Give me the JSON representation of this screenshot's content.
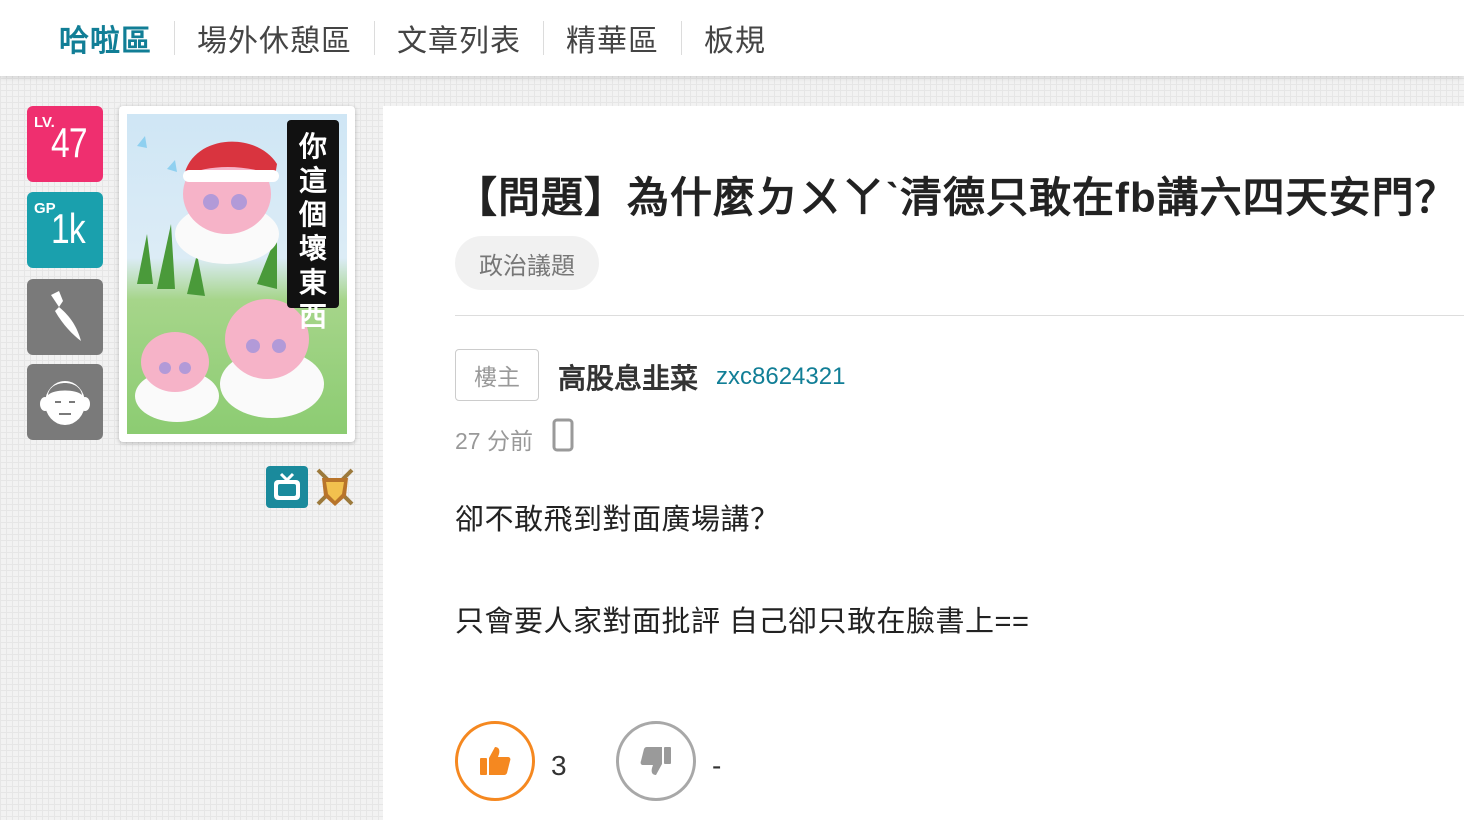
{
  "nav": {
    "items": [
      {
        "label": "哈啦區",
        "active": true
      },
      {
        "label": "場外休憩區",
        "active": false
      },
      {
        "label": "文章列表",
        "active": false
      },
      {
        "label": "精華區",
        "active": false
      },
      {
        "label": "板規",
        "active": false
      }
    ]
  },
  "user_badges": {
    "level_label": "LV.",
    "level_value": "47",
    "gp_label": "GP",
    "gp_value": "1k",
    "sword_icon": "sword-icon",
    "face_icon": "face-icon"
  },
  "avatar": {
    "caption_chars": [
      "你",
      "這",
      "個",
      "壞",
      "東",
      "西"
    ]
  },
  "post": {
    "title": "【問題】為什麼ㄉㄨㄚˋ清德只敢在fb講六四天安門？",
    "tag": "政治議題",
    "role_badge": "樓主",
    "author_name": "高股息韭菜",
    "author_id": "zxc8624321",
    "time": "27 分前",
    "device_icon": "mobile-icon",
    "body_lines": [
      "卻不敢飛到對面廣場講？",
      "只會要人家對面批評 自己卻只敢在臉書上=="
    ],
    "upvotes": "3",
    "downvotes": "-"
  },
  "colors": {
    "accent": "#117e96",
    "level_badge": "#ef2f6f",
    "gp_badge": "#1aa0ad",
    "upvote": "#f58820",
    "downvote": "#a8a8a8"
  }
}
